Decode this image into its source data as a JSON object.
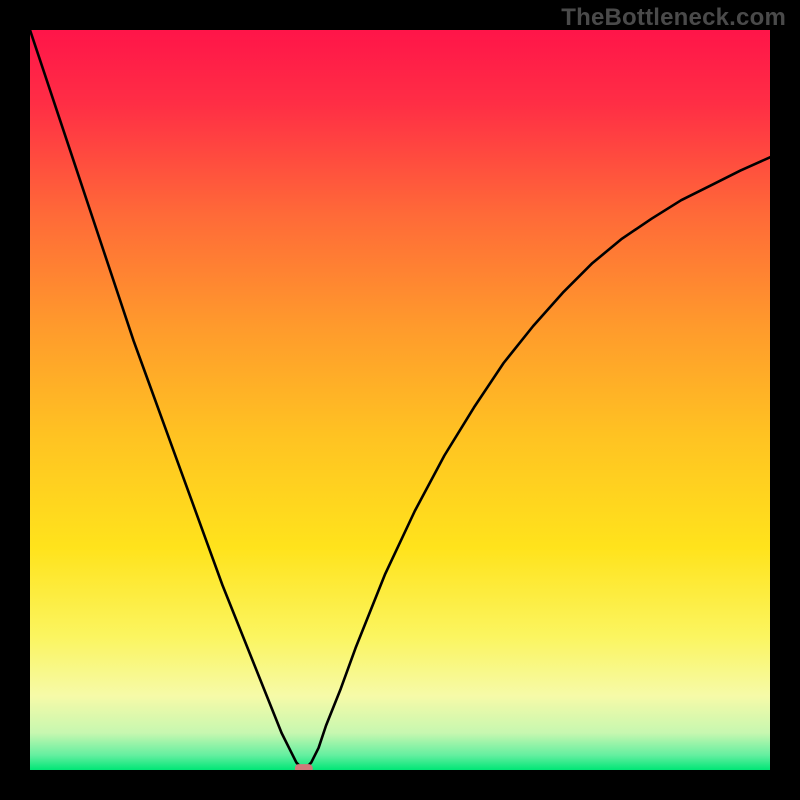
{
  "watermark": "TheBottleneck.com",
  "chart_data": {
    "type": "line",
    "title": "",
    "xlabel": "",
    "ylabel": "",
    "xlim": [
      0,
      100
    ],
    "ylim": [
      0,
      100
    ],
    "legend": false,
    "grid": false,
    "background_gradient": {
      "top_color": "#ff1744",
      "middle_color": "#ffd600",
      "bottom_color": "#00e676",
      "description": "Vertical gradient red→orange→yellow→green from top to bottom"
    },
    "series": [
      {
        "name": "curve",
        "color": "#000000",
        "x": [
          0,
          2,
          4,
          6,
          8,
          10,
          12,
          14,
          16,
          18,
          20,
          22,
          24,
          26,
          28,
          30,
          31,
          32,
          33,
          34,
          35,
          36,
          37,
          38,
          39,
          40,
          42,
          44,
          46,
          48,
          52,
          56,
          60,
          64,
          68,
          72,
          76,
          80,
          84,
          88,
          92,
          96,
          100
        ],
        "y": [
          100,
          94,
          88,
          82,
          76,
          70,
          64,
          58,
          52.5,
          47,
          41.5,
          36,
          30.5,
          25,
          20,
          15,
          12.5,
          10,
          7.5,
          5,
          3,
          1,
          0,
          1,
          3,
          6,
          11,
          16.5,
          21.5,
          26.5,
          35,
          42.5,
          49,
          55,
          60,
          64.5,
          68.5,
          71.8,
          74.5,
          77,
          79,
          81,
          82.8
        ]
      }
    ],
    "marker": {
      "name": "optimum-marker",
      "x": 37,
      "y": 0,
      "color": "#cf7a7a",
      "shape": "rounded-rect",
      "width": 2.4,
      "height": 1.6
    }
  }
}
